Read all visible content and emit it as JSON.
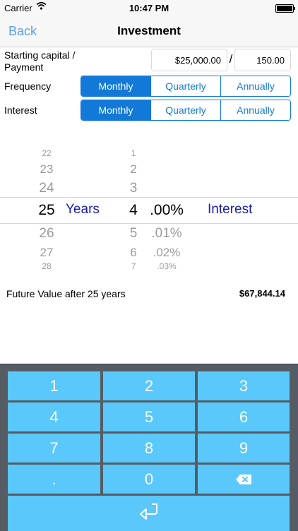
{
  "status_bar": {
    "carrier": "Carrier",
    "time": "10:47 PM"
  },
  "nav": {
    "back_label": "Back",
    "title": "Investment"
  },
  "capital": {
    "label": "Starting capital / Payment",
    "capital_value": "$25,000.00",
    "separator": "/",
    "payment_value": "150.00"
  },
  "frequency": {
    "label": "Frequency",
    "options": [
      "Monthly",
      "Quarterly",
      "Annually"
    ],
    "selected": "Monthly"
  },
  "interest": {
    "label": "Interest",
    "options": [
      "Monthly",
      "Quarterly",
      "Annually"
    ],
    "selected": "Monthly"
  },
  "picker": {
    "years": [
      "22",
      "23",
      "24",
      "25",
      "26",
      "27",
      "28"
    ],
    "years_label": "Years",
    "interest_units": [
      "1",
      "2",
      "3",
      "4",
      "5",
      "6",
      "7"
    ],
    "interest_decimals": [
      ".00%",
      ".01%",
      ".02%",
      ".03%"
    ],
    "interest_label": "Interest",
    "selected_years": "25",
    "selected_interest": "4.00%"
  },
  "result": {
    "label": "Future Value after 25 years",
    "value": "$67,844.14"
  },
  "keypad": {
    "keys": [
      "1",
      "2",
      "3",
      "4",
      "5",
      "6",
      "7",
      "8",
      "9",
      ".",
      "0"
    ],
    "backspace_icon": "backspace-icon",
    "enter_icon": "enter-icon"
  },
  "colors": {
    "accent": "#1279d9",
    "nav_link": "#5aa0f0",
    "picker_label": "#1a1ab8",
    "keypad_key": "#5ac8fa",
    "keypad_background": "#555c64"
  }
}
